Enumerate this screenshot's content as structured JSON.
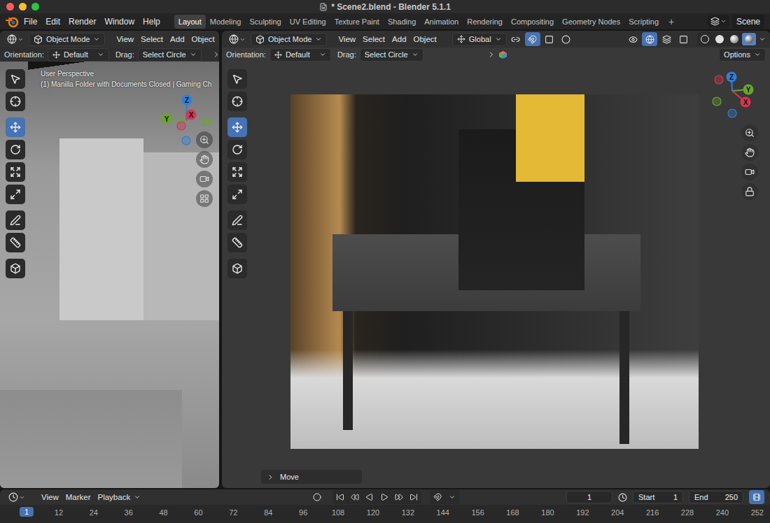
{
  "window": {
    "title": "* Scene2.blend - Blender 5.1.1",
    "controls": [
      {
        "color": "#ff5f57"
      },
      {
        "color": "#febc2e"
      },
      {
        "color": "#28c840"
      }
    ]
  },
  "menu": [
    "File",
    "Edit",
    "Render",
    "Window",
    "Help"
  ],
  "workspaces": [
    {
      "label": "Layout",
      "selected": true
    },
    {
      "label": "Modeling",
      "selected": false
    },
    {
      "label": "Sculpting",
      "selected": false
    },
    {
      "label": "UV Editing",
      "selected": false
    },
    {
      "label": "Texture Paint",
      "selected": false
    },
    {
      "label": "Shading",
      "selected": false
    },
    {
      "label": "Animation",
      "selected": false
    },
    {
      "label": "Rendering",
      "selected": false
    },
    {
      "label": "Compositing",
      "selected": false
    },
    {
      "label": "Geometry Nodes",
      "selected": false
    },
    {
      "label": "Scripting",
      "selected": false
    }
  ],
  "add_workspace": "+",
  "scene": {
    "label": "Scene"
  },
  "tools": [
    {
      "kind": "select",
      "selected": false
    },
    {
      "kind": "cursor",
      "selected": false
    },
    {
      "kind": "move",
      "selected": true
    },
    {
      "kind": "rotate",
      "selected": false
    },
    {
      "kind": "scale",
      "selected": false
    },
    {
      "kind": "transform",
      "selected": false
    },
    {
      "kind": "annotate",
      "selected": false
    },
    {
      "kind": "measure",
      "selected": false
    },
    {
      "kind": "add_cube",
      "selected": false
    }
  ],
  "viewports": [
    {
      "kind": "solid",
      "mode": "Object Mode",
      "menu": [
        "View",
        "Select",
        "Add",
        "Object"
      ],
      "tool_settings": {
        "orientation_label": "Orientation:",
        "orientation": "Default",
        "drag_label": "Drag:",
        "drag": "Select Circle"
      },
      "overlay_text": [
        "User Perspective",
        "(1) Manilla Folder with Documents Closed | Gaming Ch"
      ],
      "gizmo": [
        {
          "label": "Z",
          "color": "#2f7fd9"
        },
        {
          "label": "Y",
          "color": "#6aa52a"
        },
        {
          "label": "X",
          "color": "#d9354f"
        }
      ],
      "nav": [
        "zoom",
        "pan",
        "camera",
        "ortho"
      ]
    },
    {
      "kind": "rendered",
      "mode": "Object Mode",
      "menu": [
        "View",
        "Select",
        "Add",
        "Object"
      ],
      "transform_orientation": "Global",
      "header_tools": [
        {
          "kind": "pivot",
          "selected": false
        },
        {
          "kind": "snap",
          "selected": true
        },
        {
          "kind": "snap_target",
          "selected": false
        },
        {
          "kind": "proportional",
          "selected": false
        },
        {
          "kind": "visibility",
          "selected": false
        },
        {
          "kind": "gizmo",
          "selected": true
        },
        {
          "kind": "overlay",
          "selected": false
        },
        {
          "kind": "xray",
          "selected": false
        }
      ],
      "shading": [
        {
          "kind": "wireframe",
          "selected": false
        },
        {
          "kind": "solid",
          "selected": false
        },
        {
          "kind": "material",
          "selected": false
        },
        {
          "kind": "rendered",
          "selected": true
        }
      ],
      "tool_settings": {
        "orientation_label": "Orientation:",
        "orientation": "Default",
        "drag_label": "Drag:",
        "drag": "Select Circle",
        "options": "Options"
      },
      "gizmo": [
        {
          "label": "Z",
          "color": "#2f7fd9"
        },
        {
          "label": "Y",
          "color": "#6aa52a"
        },
        {
          "label": "X",
          "color": "#d9354f"
        }
      ],
      "nav": [
        "zoom",
        "pan",
        "camera",
        "lock"
      ],
      "operator_panel": {
        "label": "Move",
        "expanded": false
      }
    }
  ],
  "timeline": {
    "menu": [
      "View",
      "Marker"
    ],
    "playback": "Playback",
    "current_frame": "1",
    "start_label": "Start",
    "start": "1",
    "end_label": "End",
    "end": "250",
    "ruler": [
      {
        "label": "1",
        "selected": true
      },
      {
        "label": "12",
        "selected": false
      },
      {
        "label": "24",
        "selected": false
      },
      {
        "label": "36",
        "selected": false
      },
      {
        "label": "48",
        "selected": false
      },
      {
        "label": "60",
        "selected": false
      },
      {
        "label": "72",
        "selected": false
      },
      {
        "label": "84",
        "selected": false
      },
      {
        "label": "96",
        "selected": false
      },
      {
        "label": "108",
        "selected": false
      },
      {
        "label": "120",
        "selected": false
      },
      {
        "label": "132",
        "selected": false
      },
      {
        "label": "144",
        "selected": false
      },
      {
        "label": "156",
        "selected": false
      },
      {
        "label": "168",
        "selected": false
      },
      {
        "label": "180",
        "selected": false
      },
      {
        "label": "192",
        "selected": false
      },
      {
        "label": "204",
        "selected": false
      },
      {
        "label": "216",
        "selected": false
      },
      {
        "label": "228",
        "selected": false
      },
      {
        "label": "240",
        "selected": false
      },
      {
        "label": "252",
        "selected": false
      }
    ]
  }
}
